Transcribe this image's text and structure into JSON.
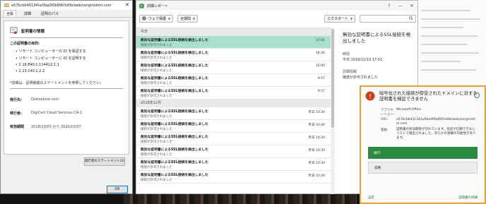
{
  "certificate": {
    "title": "a57bcbb45134/a/0ba0f0b8903d0b/web/oorgmsktm.com",
    "tabs": [
      "全般",
      "詳細",
      "証明のパス"
    ],
    "info_title": "証明書の情報",
    "purpose_heading": "この証明書の目的:",
    "purposes": [
      "リモート コンピューターの ID を保証する",
      "リモート コンピューターに ID を証明する",
      "2.16.840.1.114412.1.1",
      "2.23.140.1.2.2"
    ],
    "note": "*詳細は、証明機関のステートメントを参照してください。",
    "issued_to_label": "発行先:",
    "issued_to_value": "Outlookive.com",
    "issued_by_label": "発行者:",
    "issued_by_value": "DigiCert Cloud Services CA-1",
    "valid_label": "有効期間",
    "valid_value": "2018/10/03 から 2020/10/07",
    "statement_button": "発行者のステートメント(S)",
    "ok_button": "OK"
  },
  "report": {
    "title": "詳細レポート",
    "filter1": "ウェブ保護",
    "filter2": "全期間",
    "export_button": "エクスポート",
    "group_today": "今日",
    "group_month": "2018年12月",
    "row_title": "無効な証明書によるSSL接続を検出しました",
    "row_subtitle": "接続が許可されました",
    "rows_today": [
      {
        "time": "17:01",
        "selected": true
      },
      {
        "time": "16:36",
        "selected": false
      },
      {
        "time": "16:00",
        "selected": false
      },
      {
        "time": "9:57",
        "selected": false
      },
      {
        "time": "9:57",
        "selected": false
      }
    ],
    "rows_month": [
      {
        "time": "昨日 10:30"
      },
      {
        "time": "昨日 10:30"
      },
      {
        "time": "昨日 10:30"
      },
      {
        "time": "昨日 10:30"
      },
      {
        "time": "昨日 10:30"
      },
      {
        "time": "昨日 10:30"
      }
    ],
    "detail": {
      "title": "無効な証明書によるSSL接続を検出しました",
      "date_label": "時間",
      "date_value": "今日 2018/12/10 17:01",
      "source_label": "詳細情報",
      "source_value": "接続が許可されました"
    }
  },
  "notification": {
    "title": "暗号化された接続が傍受されたドメインに対する証明書を検証できません",
    "app_label": "アプリケーション:",
    "app_value": "Microsoft Office",
    "url_label": "URL:",
    "url_value": "a57bcbb45134/a/0ba0f0b8903d0b/web/oorgmsktm.com",
    "reason_label": "理由:",
    "reason_value": "証明書の有効期限が切れています。名前が信頼できないリストで検出されました。何らかの攻撃の可能性があります。",
    "allow_button": "続行",
    "block_button": "遮断",
    "footer_left": "設定",
    "footer_right": "証明書の詳細"
  },
  "colors": {
    "selected_row": "#a8e0d0",
    "allow_green": "#2b8a3e",
    "notif_border": "#f0a030"
  }
}
